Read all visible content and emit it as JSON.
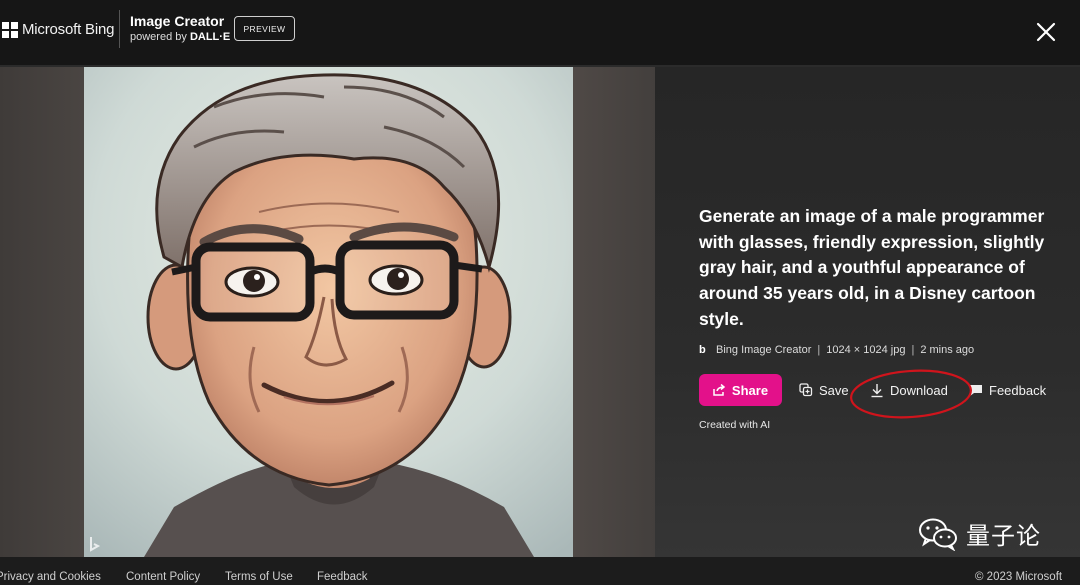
{
  "header": {
    "brand": "Microsoft Bing",
    "app_title": "Image Creator",
    "powered_by": "powered by",
    "powered_by_brand": "DALL·E",
    "badge": "PREVIEW",
    "close_icon": "close-icon"
  },
  "image": {
    "subject_icon": "generated-portrait",
    "corner_logo": "bing-b-logo"
  },
  "details": {
    "prompt": "Generate an image of a male programmer with glasses, friendly expression, slightly gray hair, and a youthful appearance of around 35 years old, in a Disney cartoon style.",
    "source": "Bing Image Creator",
    "dimensions": "1024 × 1024 jpg",
    "time": "2 mins ago",
    "separator": "|",
    "created_with": "Created with AI"
  },
  "actions": {
    "share": "Share",
    "save": "Save",
    "download": "Download",
    "feedback": "Feedback"
  },
  "colors": {
    "share_bg": "#e3118a",
    "highlight": "#d0141c",
    "header_bg": "#161616"
  },
  "watermark": {
    "text": "量子论",
    "icon": "wechat-icon"
  },
  "footer": {
    "links": [
      "Privacy and Cookies",
      "Content Policy",
      "Terms of Use",
      "Feedback"
    ],
    "copyright": "© 2023 Microsoft"
  }
}
